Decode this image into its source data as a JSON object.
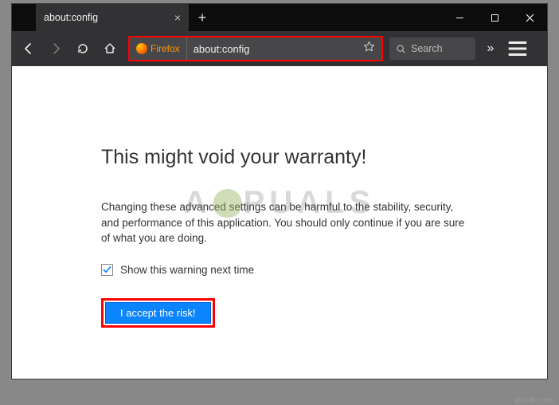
{
  "tab": {
    "title": "about:config",
    "close_glyph": "×"
  },
  "newtab_glyph": "+",
  "toolbar": {
    "firefox_label": "Firefox",
    "url": "about:config",
    "search_placeholder": "Search",
    "overflow_glyph": "»"
  },
  "page": {
    "heading": "This might void your warranty!",
    "body": "Changing these advanced settings can be harmful to the stability, security, and performance of this application. You should only continue if you are sure of what you are doing.",
    "checkbox_label": "Show this warning next time",
    "checkbox_checked": true,
    "accept_label": "I accept the risk!"
  },
  "watermark_left": "A",
  "watermark_right": "PUALS",
  "credit": "wsxdn.com",
  "highlight_color": "#ff0000",
  "accent_color": "#0a84ff"
}
